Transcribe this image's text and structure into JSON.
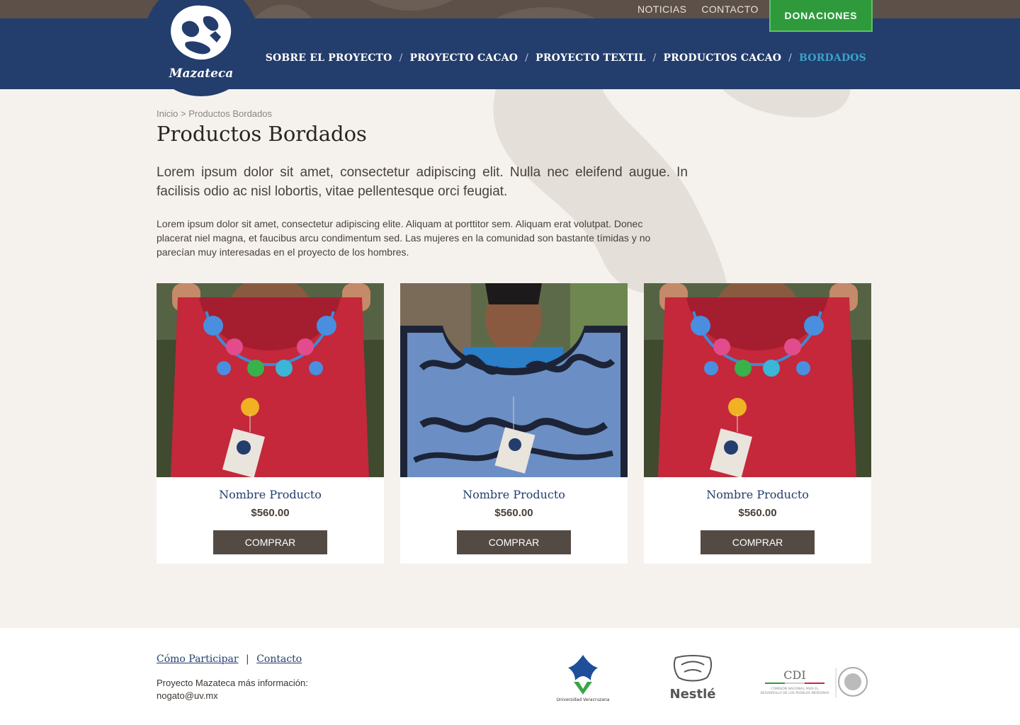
{
  "topnav": {
    "links": [
      "NOTICIAS",
      "CONTACTO"
    ],
    "donate_label": "DONACIONES"
  },
  "brand": {
    "name": "Mazateca"
  },
  "mainnav": {
    "items": [
      {
        "label": "SOBRE EL PROYECTO",
        "active": false
      },
      {
        "label": "PROYECTO CACAO",
        "active": false
      },
      {
        "label": "PROYECTO TEXTIL",
        "active": false
      },
      {
        "label": "PRODUCTOS CACAO",
        "active": false
      },
      {
        "label": "BORDADOS",
        "active": true
      }
    ],
    "separator": "/",
    "active_color": "#3aa3c9"
  },
  "breadcrumb": {
    "home": "Inicio",
    "sep": ">",
    "current": "Productos Bordados"
  },
  "page": {
    "title": "Productos Bordados",
    "lead": "Lorem ipsum dolor sit amet, consectetur adipiscing elit. Nulla nec eleifend augue. In facilisis odio ac nisl lobortis, vitae pellentesque orci feugiat.",
    "body": "Lorem ipsum dolor sit amet, consectetur adipiscing elite. Aliquam at porttitor sem. Aliquam erat volutpat. Donec placerat niel magna, et faucibus arcu condimentum sed. Las mujeres en la comunidad son bastante tímidas y no parecían muy interesadas en el proyecto de los hombres."
  },
  "products": [
    {
      "name": "Nombre Producto",
      "price": "$560.00",
      "button": "COMPRAR",
      "image": "red-embroidered-blouse"
    },
    {
      "name": "Nombre Producto",
      "price": "$560.00",
      "button": "COMPRAR",
      "image": "blue-embroidered-blouse"
    },
    {
      "name": "Nombre Producto",
      "price": "$560.00",
      "button": "COMPRAR",
      "image": "red-embroidered-blouse"
    }
  ],
  "footer": {
    "links": [
      "Cómo Participar",
      "Contacto"
    ],
    "info_line1": "Proyecto Mazateca más información:",
    "info_line2": "nogato@uv.mx",
    "partners": [
      "Universidad Veracruzana",
      "Nestlé",
      "CDI"
    ]
  },
  "colors": {
    "navbar": "#233d6c",
    "topbar": "#5c5048",
    "donate": "#2e9a3c",
    "button": "#544a44",
    "background": "#f5f2ee"
  }
}
